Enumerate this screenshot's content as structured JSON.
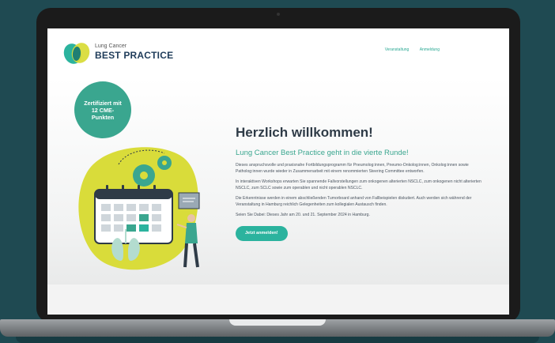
{
  "header": {
    "brand_small": "Lung Cancer",
    "brand_large": "BEST PRACTICE",
    "nav": [
      "Veranstaltung",
      "Anmeldung"
    ]
  },
  "badge": {
    "text": "Zertifiziert mit 12 CME-Punkten"
  },
  "main": {
    "title": "Herzlich willkommen!",
    "subtitle": "Lung Cancer Best Practice geht in die vierte Runde!",
    "paragraphs": [
      "Dieses anspruchsvolle und praxisnahe Fortbildungsprogramm für Pneumolog:innen, Pneumo-Onkolog:innen, Onkolog:innen sowie Patholog:innen wurde wieder in Zusammenarbeit mit einem renommierten Steering Committee entworfen.",
      "In interaktiven Workshops erwarten Sie spannende Fallvorstellungen zum onkogenen alterierten NSCLC, zum onkogenen nicht alterierten NSCLC, zum SCLC sowie zum operablen und nicht operablen NSCLC.",
      "Die Erkenntnisse werden in einem abschließenden Tumorboard anhand von Fallbeispielen diskutiert. Auch werden sich während der Veranstaltung in Hamburg reichlich Gelegenheiten zum kollegialen Austausch finden.",
      "Seien Sie Dabei: Dieses Jahr am 20. und 21. September 2024 in Hamburg."
    ],
    "cta_label": "Jetzt anmelden!"
  },
  "colors": {
    "background": "#1f4a52",
    "accent": "#2bb39e",
    "badge": "#3aa68f",
    "title": "#2f3b47",
    "illustration_blob": "#d9dc3a"
  }
}
